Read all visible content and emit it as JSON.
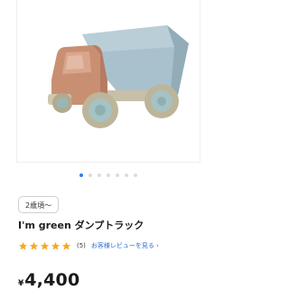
{
  "product": {
    "age_badge": "2歳頃〜",
    "title": "I'm green ダンプトラック",
    "rating": {
      "stars": 5,
      "count": "(5)",
      "reviews_link": "お客様レビューを見る",
      "link_chevron": "›"
    },
    "price": {
      "currency": "¥",
      "amount": "4,400"
    }
  },
  "carousel": {
    "total": 7,
    "active_index": 0
  },
  "colors": {
    "accent": "#2f7cf6",
    "star": "#f7a821",
    "link": "#2f6fd6"
  }
}
